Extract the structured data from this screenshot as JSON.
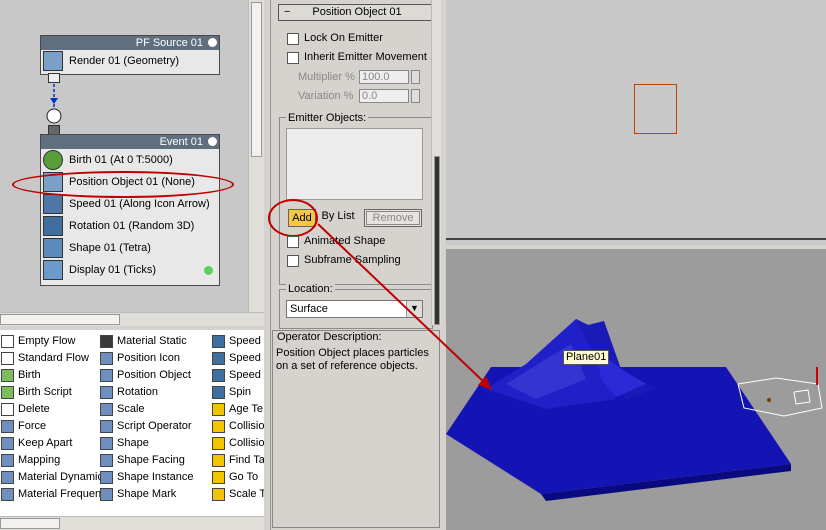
{
  "particle_view": {
    "source_node": {
      "title": "PF Source 01",
      "ops": [
        {
          "label": "Render 01 (Geometry)",
          "icon": "render-teapot-icon"
        }
      ]
    },
    "event_node": {
      "title": "Event 01",
      "ops": [
        {
          "label": "Birth 01 (At 0 T:5000)",
          "icon": "birth-icon"
        },
        {
          "label": "Position Object 01 (None)",
          "icon": "position-object-icon"
        },
        {
          "label": "Speed 01 (Along Icon Arrow)",
          "icon": "speed-icon"
        },
        {
          "label": "Rotation 01 (Random 3D)",
          "icon": "rotation-icon"
        },
        {
          "label": "Shape 01 (Tetra)",
          "icon": "shape-icon"
        },
        {
          "label": "Display 01 (Ticks)",
          "icon": "display-icon"
        }
      ]
    }
  },
  "depot": {
    "col1": [
      "Empty Flow",
      "Standard Flow",
      "Birth",
      "Birth Script",
      "Delete",
      "Force",
      "Keep Apart",
      "Mapping",
      "Material Dynamic",
      "Material Frequency"
    ],
    "col2": [
      "Material Static",
      "Position Icon",
      "Position Object",
      "Rotation",
      "Scale",
      "Script Operator",
      "Shape",
      "Shape Facing",
      "Shape Instance",
      "Shape Mark"
    ],
    "col3": [
      "Speed",
      "Speed",
      "Speed",
      "Spin",
      "Age Te",
      "Collision",
      "Collision",
      "Find Ta",
      "Go To",
      "Scale T"
    ]
  },
  "params": {
    "rollout_title": "Position Object 01",
    "lock_on_emitter": "Lock On Emitter",
    "inherit_movement": "Inherit Emitter Movement",
    "multiplier_label": "Multiplier %",
    "multiplier_value": "100.0",
    "variation_label": "Variation %",
    "variation_value": "0.0",
    "emitter_objects_label": "Emitter Objects:",
    "add_button": "Add",
    "by_list_button": "By List",
    "remove_button": "Remove",
    "animated_shape": "Animated Shape",
    "subframe_sampling": "Subframe Sampling",
    "location_label": "Location:",
    "location_value": "Surface"
  },
  "operator_description": {
    "title": "Operator Description:",
    "text": "Position Object places particles on a set of reference objects."
  },
  "viewport": {
    "object_label": "Plane01"
  },
  "colors": {
    "highlight_red": "#c00000",
    "terrain_blue": "#1010b0",
    "add_button_yellow": "#f5c842"
  }
}
